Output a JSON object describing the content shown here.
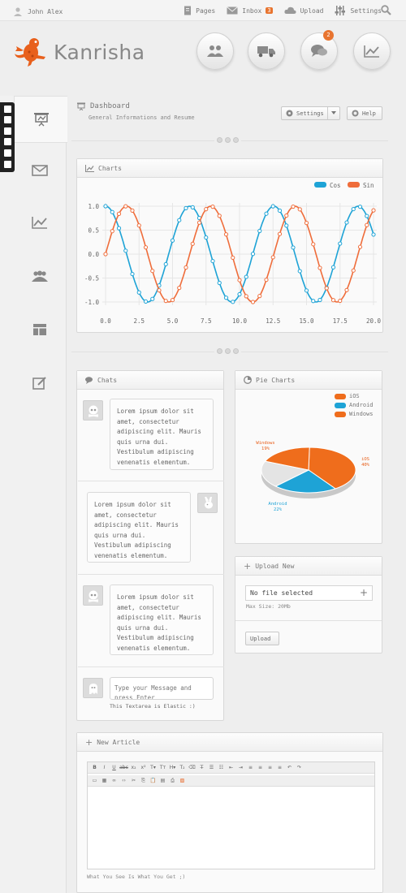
{
  "topbar": {
    "user_name": "John Alex",
    "links": [
      {
        "label": "Pages",
        "icon": "pages-icon"
      },
      {
        "label": "Inbox",
        "icon": "mail-icon",
        "badge": "3"
      },
      {
        "label": "Upload",
        "icon": "cloud-icon"
      },
      {
        "label": "Settings",
        "icon": "sliders-icon"
      }
    ]
  },
  "logo": {
    "text": "Kanrisha"
  },
  "quick_buttons": [
    {
      "name": "users",
      "icon": "users-icon"
    },
    {
      "name": "delivery",
      "icon": "truck-icon"
    },
    {
      "name": "chat",
      "icon": "chat-bubbles-icon",
      "badge": "2"
    },
    {
      "name": "stats",
      "icon": "line-chart-icon"
    }
  ],
  "sidebar": {
    "items": [
      {
        "name": "dashboard",
        "icon": "presentation-icon",
        "active": true
      },
      {
        "name": "mail",
        "icon": "mail-icon"
      },
      {
        "name": "charts",
        "icon": "line-chart-icon"
      },
      {
        "name": "users",
        "icon": "users-icon"
      },
      {
        "name": "layout",
        "icon": "layout-icon"
      },
      {
        "name": "edit",
        "icon": "edit-icon"
      }
    ]
  },
  "dashboard": {
    "title": "Dashboard",
    "subtitle": "General Informations and Resume",
    "settings_label": "Settings",
    "help_label": "Help"
  },
  "charts_panel": {
    "title": "Charts"
  },
  "chart_data": [
    {
      "type": "line",
      "series": [
        {
          "name": "Cos",
          "color": "#1ea3d6",
          "function": "cos(x)"
        },
        {
          "name": "Sin",
          "color": "#ef6d3b",
          "function": "sin(x)"
        }
      ],
      "x_range": [
        0,
        20
      ],
      "x_step": 0.5,
      "xticks": [
        "0.0",
        "2.5",
        "5.0",
        "7.5",
        "10.0",
        "12.5",
        "15.0",
        "17.5",
        "20.0"
      ],
      "ylim": [
        -1,
        1
      ],
      "yticks": [
        "1.0",
        "0.5",
        "0.0",
        "-0.5",
        "-1.0"
      ],
      "grid": true,
      "legend": "top-right"
    },
    {
      "type": "pie",
      "title": "Pie Charts",
      "slices": [
        {
          "label": "iOS",
          "value": 40,
          "color": "#ef6d1c"
        },
        {
          "label": "Android",
          "value": 22,
          "color": "#1ea3d6"
        },
        {
          "label": "Windows",
          "value": 19,
          "color": "#ef6d1c"
        }
      ],
      "slice_labels": [
        {
          "name": "iOS",
          "pct": "40%"
        },
        {
          "name": "Android",
          "pct": "22%"
        },
        {
          "name": "Windows",
          "pct": "19%"
        }
      ],
      "legend": "top-right"
    }
  ],
  "chats": {
    "title": "Chats",
    "messages": [
      {
        "text": "Lorem ipsum dolor sit amet, consectetur adipiscing elit. Mauris quis urna dui. Vestibulum adipiscing venenatis elementum.",
        "side": "left"
      },
      {
        "text": "Lorem ipsum dolor sit amet, consectetur adipiscing elit. Mauris quis urna dui. Vestibulum adipiscing venenatis elementum.",
        "side": "right"
      },
      {
        "text": "Lorem ipsum dolor sit amet, consectetur adipiscing elit. Mauris quis urna dui. Vestibulum adipiscing venenatis elementum.",
        "side": "left"
      }
    ],
    "input_placeholder": "Type your Message and press Enter",
    "input_hint": "This Textarea is Elastic :)"
  },
  "upload": {
    "title": "Upload New",
    "file_label": "No file selected",
    "max_size": "Max Size: 20Mb",
    "button_label": "Upload"
  },
  "article": {
    "title": "New Article",
    "footer": "What You See Is What You Get ;)"
  }
}
